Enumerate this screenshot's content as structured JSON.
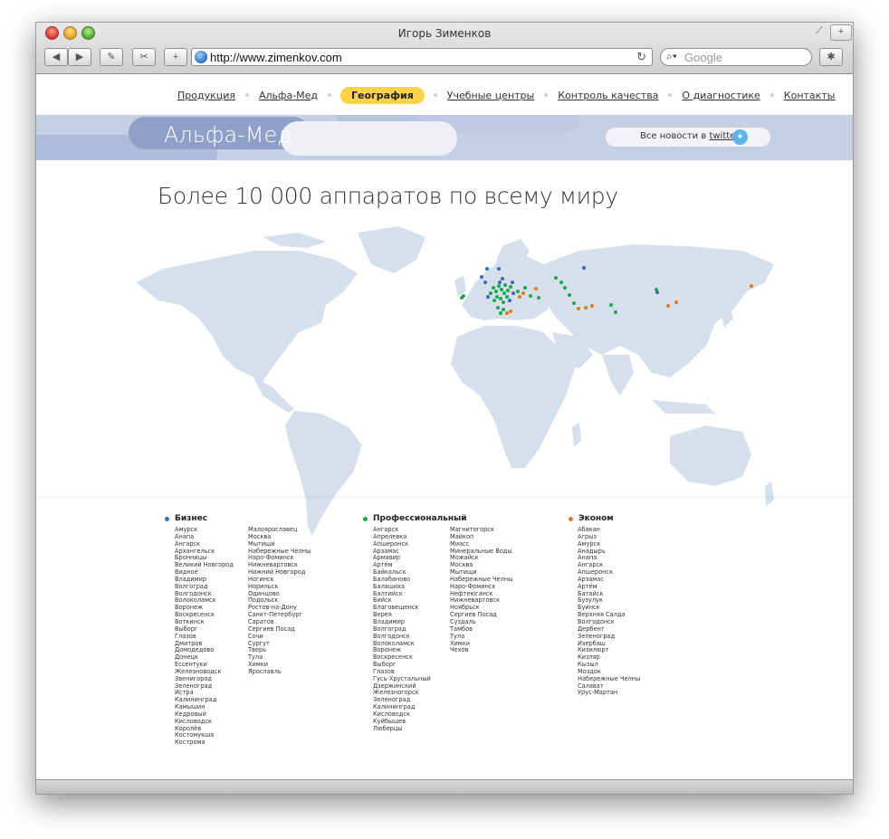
{
  "window": {
    "title": "Игорь Зименков"
  },
  "toolbar": {
    "url": "http://www.zimenkov.com",
    "search_placeholder": "Google"
  },
  "nav": {
    "items": [
      "Продукция",
      "Альфа-Мед",
      "География",
      "Учебные центры",
      "Контроль качества",
      "О диагностике",
      "Контакты"
    ],
    "active_index": 2
  },
  "banner": {
    "title": "Альфа-Мед",
    "news_prefix": "Все новости в",
    "news_link": "twitter"
  },
  "main": {
    "heading": "Более 10 000 аппаратов по всему миру"
  },
  "legend": {
    "business": {
      "title": "Бизнес",
      "color": "#3b6cb7",
      "col1": [
        "Амурск",
        "Анапа",
        "Ангарск",
        "Архангельск",
        "Бронницы",
        "Великий Новгород",
        "Видное",
        "Владимир",
        "Волгоград",
        "Волгодонск",
        "Волоколамск",
        "Воронеж",
        "Воскресенск",
        "Воткинск",
        "Выборг",
        "Глазов",
        "Дмитров",
        "Домодедово",
        "Донецк",
        "Ессентуки",
        "Железноводск",
        "Звенигород",
        "Зеленоград",
        "Истра",
        "Калининград",
        "Камышин",
        "Кедровый",
        "Кисловодск",
        "Королёв",
        "Костомукша",
        "Кострома"
      ],
      "col2": [
        "Малоярославец",
        "Москва",
        "Мытищи",
        "Набережные Челны",
        "Наро-Фоминск",
        "Нижневартовск",
        "Нижний Новгород",
        "Ногинск",
        "Норильск",
        "Одинцово",
        "Подольск",
        "Ростов-на-Дону",
        "Санкт-Петербург",
        "Саратов",
        "Сергиев Посад",
        "Сочи",
        "Сургут",
        "Тверь",
        "Тула",
        "Химки",
        "Ярославль"
      ]
    },
    "professional": {
      "title": "Профессиональный",
      "color": "#19a84a",
      "col1": [
        "Ангарск",
        "Апрелевка",
        "Апшеронск",
        "Арзамас",
        "Армавир",
        "Артём",
        "Байкальск",
        "Балабаново",
        "Балашиха",
        "Балтийск",
        "Бийск",
        "Благовещенск",
        "Верея",
        "Владимир",
        "Волгоград",
        "Волгодонск",
        "Волоколамск",
        "Воронеж",
        "Воскресенск",
        "Выборг",
        "Глазов",
        "Гусь-Хрустальный",
        "Дзержинский",
        "Железногорск",
        "Зеленоград",
        "Калининград",
        "Кисловодск",
        "Куйбышев",
        "Люберцы"
      ],
      "col2": [
        "Магнитогорск",
        "Майкоп",
        "Миасс",
        "Минеральные Воды",
        "Можайск",
        "Москва",
        "Мытищи",
        "Набережные Челны",
        "Наро-Фоминск",
        "Нефтеюганск",
        "Нижневартовск",
        "Ноябрьск",
        "Сергиев Посад",
        "Суздаль",
        "Тамбов",
        "Тула",
        "Химки",
        "Чехов"
      ]
    },
    "economy": {
      "title": "Эконом",
      "color": "#e07a1a",
      "col1": [
        "Абакан",
        "Агрыз",
        "Амурск",
        "Анадырь",
        "Анапа",
        "Ангарск",
        "Апшеронск",
        "Арзамас",
        "Артём",
        "Батайск",
        "Бузулук",
        "Буинск",
        "Верхняя Салда",
        "Волгодонск",
        "Дербент",
        "Зеленоград",
        "Изербаш",
        "Кизилюрт",
        "Кизляр",
        "Кызыл",
        "Моздок",
        "Набережные Челны",
        "Салават",
        "Урус-Мартан"
      ]
    }
  }
}
